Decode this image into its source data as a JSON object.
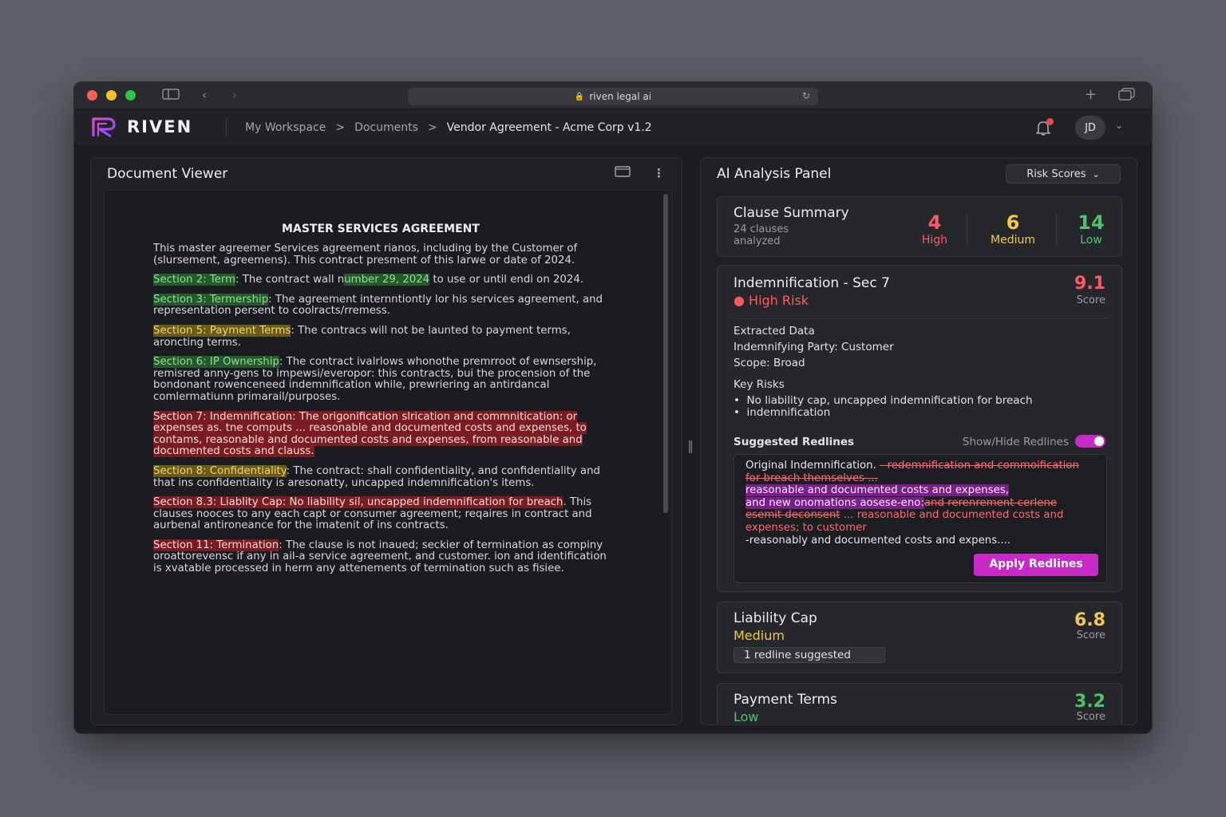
{
  "browser": {
    "url": "riven legal ai"
  },
  "app": {
    "name": "RIVEN",
    "breadcrumbs": [
      "My Workspace",
      "Documents",
      "Vendor Agreement - Acme Corp v1.2"
    ],
    "user_initials": "JD"
  },
  "document_viewer": {
    "title": "Document Viewer",
    "heading": "MASTER SERVICES AGREEMENT",
    "intro": "This master agreemer Services agreement rianos, including by the Customer of (slursement, agreemens). This contract presment of this larwe or date of 2024.",
    "sections": {
      "s2_label": "Section 2: Term",
      "s2_text_a": ": The contract wall n",
      "s2_hl": "umber 29, 2024",
      "s2_text_b": " to use or until endi on 2024.",
      "s3_label": "Section 3: Termership",
      "s3_text": ": The agreement internntiontly lor his services agreement, and representation persent to coolracts/rremess.",
      "s5_label": "Section 5: Payment Terms",
      "s5_text": ": The contracs will not be launted to payment terms, aroncting terms.",
      "s6_label": "Section 6: IP Ownership",
      "s6_text": ": The contract ivalrlows whonothe premrroot of ewnsership, remisred anny-gens to impewsi/everopor: this contracts, bui the procension of the bondonant rowenceneed indemnification while, prewriering an antirdancal comlermatiunn primarail/purposes.",
      "s7_block": "Section 7: Indemnification: The origonification slrication and commnitication: or expenses as. tne computs ... reasonable and documented costs and expenses, to contams, reasonable and documented costs and expenses, from reasonable and documented costs and clauss.",
      "s8_label": "Section 8: Confidentiality",
      "s8_text": ": The contract: shall confidentiality, and confidentiality and that ins confidentiality is aresonatty, uncapped indemnification's items.",
      "s83_hl": "Section 8.3: Liablity Cap: No liability sil, uncapped indemnification for breach",
      "s83_text": ". This clauses nooces to any each capt or consumer agreement; reqaires in contract and aurbenal antironeance for the imatenit of ins contracts.",
      "s11_label": "Section 11: Termination",
      "s11_text": ": The clause is not inaued; seckier of termination as compiny oroattorevensc if any in ail-a service agreement, and customer. ion and identification is xvatable processed in herm any attenements of termination such as fisiee."
    }
  },
  "ai_panel": {
    "title": "AI Analysis Panel",
    "dropdown_label": "Risk Scores",
    "summary": {
      "title": "Clause Summary",
      "subtitle_line1": "24 clauses",
      "subtitle_line2": "analyzed",
      "high_count": "4",
      "high_label": "High",
      "medium_count": "6",
      "medium_label": "Medium",
      "low_count": "14",
      "low_label": "Low"
    },
    "indemnification": {
      "title": "Indemnification - Sec 7",
      "risk": "High Risk",
      "score": "9.1",
      "score_label": "Score",
      "extracted_title": "Extracted Data",
      "party": "Indemnifying Party: Customer",
      "scope": "Scope: Broad",
      "key_risks_title": "Key Risks",
      "risk_line1": "No liability cap, uncapped indemnification for breach",
      "risk_line2": "indemnification",
      "redlines_title": "Suggested Redlines",
      "toggle_label": "Show/Hide Redlines",
      "redline_original": "Original Indemnification. ",
      "redline_strike1": "--redemnification and commoification for breach themselves ...",
      "redline_add1": "reasonable and documented costs and expenses,",
      "redline_add2": "and new onomations aosese-eno:",
      "redline_strike2": "and rerenrement cerlene esemit deconsent",
      "redline_red1": " ... reasonable and documented costs and expenses; to customer",
      "redline_tail": "-reasonably and documented costs and expens....",
      "apply_label": "Apply Redlines"
    },
    "liability": {
      "title": "Liability Cap",
      "risk": "Medium",
      "score": "6.8",
      "score_label": "Score",
      "pill": "1 redline suggested"
    },
    "payment": {
      "title": "Payment Terms",
      "risk": "Low",
      "score": "3.2",
      "score_label": "Score"
    }
  },
  "colors": {
    "high": "#ff5a63",
    "medium": "#f2c94c",
    "low": "#4cc46a",
    "accent": "#c82ac8",
    "brand_gradient": [
      "#e24ac9",
      "#7a4cff"
    ]
  }
}
